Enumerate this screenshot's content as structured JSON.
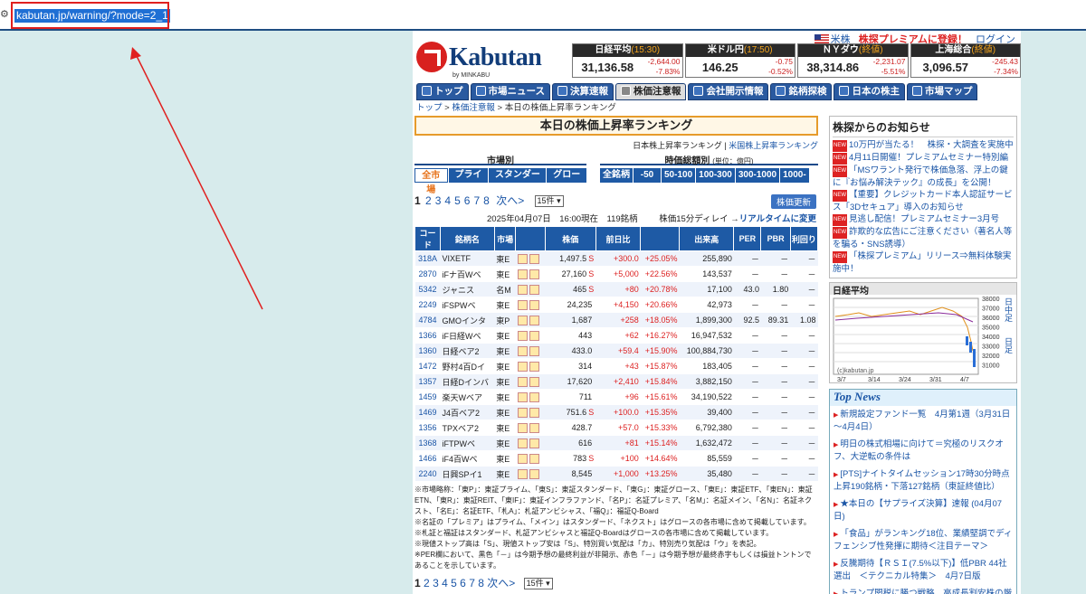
{
  "address": {
    "url": "kabutan.jp/warning/?mode=2_1"
  },
  "header": {
    "logo": "Kabutan",
    "logo_by": "by MINKABU",
    "us_link": "米株",
    "premium_link": "株探プレミアムに登録！",
    "login": "ログイン"
  },
  "tickers": [
    {
      "name": "日経平均",
      "time": "(15:30)",
      "value": "31,136.58",
      "change": "-2,644.00",
      "pct": "-7.83%"
    },
    {
      "name": "米ドル円",
      "time": "(17:50)",
      "value": "146.25",
      "change": "-0.75",
      "pct": "-0.52%"
    },
    {
      "name": "ＮＹダウ",
      "time": "(終値)",
      "value": "38,314.86",
      "change": "-2,231.07",
      "pct": "-5.51%"
    },
    {
      "name": "上海総合",
      "time": "(終値)",
      "value": "3,096.57",
      "change": "-245.43",
      "pct": "-7.34%"
    }
  ],
  "nav": [
    "トップ",
    "市場ニュース",
    "決算速報",
    "株価注意報",
    "会社開示情報",
    "銘柄探検",
    "日本の株主",
    "市場マップ"
  ],
  "breadcrumb": {
    "top": "トップ",
    "section": "株価注意報",
    "current": "本日の株価上昇率ランキング"
  },
  "page_title": "本日の株価上昇率ランキング",
  "sublinks": {
    "jp": "日本株上昇率ランキング",
    "sep": "|",
    "us": "米国株上昇率ランキング"
  },
  "filters": {
    "market_label": "市場別",
    "market": [
      "全市場",
      "プライム",
      "スタンダード",
      "グロース"
    ],
    "cap_label": "時価総額別",
    "cap_unit": "(単位：億円)",
    "cap": [
      "全銘柄",
      "-50",
      "50-100",
      "100-300",
      "300-1000",
      "1000-"
    ]
  },
  "pager": {
    "pages": [
      "1",
      "2",
      "3",
      "4",
      "5",
      "6",
      "7",
      "8"
    ],
    "next": "次へ>",
    "per_page": "15件"
  },
  "update_button": "株価更新",
  "dateline": "2025年04月07日　16:00現在　119銘柄",
  "delay_note": "株価15分ディレイ →",
  "realtime_link": "リアルタイムに変更",
  "table": {
    "headers": [
      "コード",
      "銘柄名",
      "市場",
      "",
      "株価",
      "前日比",
      "",
      "出来高",
      "PER",
      "PBR",
      "利回り"
    ],
    "rows": [
      [
        "318A",
        "VIXETF",
        "東E",
        "1,497.5",
        "S",
        "+300.0",
        "+25.05%",
        "255,890",
        "－",
        "－",
        "－"
      ],
      [
        "2870",
        "iFナ百Wベ",
        "東E",
        "27,160",
        "S",
        "+5,000",
        "+22.56%",
        "143,537",
        "－",
        "－",
        "－"
      ],
      [
        "5342",
        "ジャニス",
        "名M",
        "465",
        "S",
        "+80",
        "+20.78%",
        "17,100",
        "43.0",
        "1.80",
        "－"
      ],
      [
        "2249",
        "iFSPWベ",
        "東E",
        "24,235",
        "",
        "+4,150",
        "+20.66%",
        "42,973",
        "－",
        "－",
        "－"
      ],
      [
        "4784",
        "GMOインタ",
        "東P",
        "1,687",
        "",
        "+258",
        "+18.05%",
        "1,899,300",
        "92.5",
        "89.31",
        "1.08"
      ],
      [
        "1366",
        "iF日経Wベ",
        "東E",
        "443",
        "",
        "+62",
        "+16.27%",
        "16,947,532",
        "－",
        "－",
        "－"
      ],
      [
        "1360",
        "日経ベア2",
        "東E",
        "433.0",
        "",
        "+59.4",
        "+15.90%",
        "100,884,730",
        "－",
        "－",
        "－"
      ],
      [
        "1472",
        "野村4百Dイ",
        "東E",
        "314",
        "",
        "+43",
        "+15.87%",
        "183,405",
        "－",
        "－",
        "－"
      ],
      [
        "1357",
        "日経Dインバ",
        "東E",
        "17,620",
        "",
        "+2,410",
        "+15.84%",
        "3,882,150",
        "－",
        "－",
        "－"
      ],
      [
        "1459",
        "楽天Wベア",
        "東E",
        "711",
        "",
        "+96",
        "+15.61%",
        "34,190,522",
        "－",
        "－",
        "－"
      ],
      [
        "1469",
        "J4百ベア2",
        "東E",
        "751.6",
        "S",
        "+100.0",
        "+15.35%",
        "39,400",
        "－",
        "－",
        "－"
      ],
      [
        "1356",
        "TPXベア2",
        "東E",
        "428.7",
        "",
        "+57.0",
        "+15.33%",
        "6,792,380",
        "－",
        "－",
        "－"
      ],
      [
        "1368",
        "iFTPWベ",
        "東E",
        "616",
        "",
        "+81",
        "+15.14%",
        "1,632,472",
        "－",
        "－",
        "－"
      ],
      [
        "1466",
        "iF4百Wベ",
        "東E",
        "783",
        "S",
        "+100",
        "+14.64%",
        "85,559",
        "－",
        "－",
        "－"
      ],
      [
        "2240",
        "日興SPイ1",
        "東E",
        "8,545",
        "",
        "+1,000",
        "+13.25%",
        "35,480",
        "－",
        "－",
        "－"
      ]
    ]
  },
  "notes": [
    "※市場略称：「東P」：東証プライム、「東S」：東証スタンダード、「東G」：東証グロース、「東E」：東証ETF、「東EN」：東証ETN、「東R」：東証REIT、「東IF」：東証インフラファンド、「名P」：名証プレミア、「名M」：名証メイン、「名N」：名証ネクスト、「名E」：名証ETF、「札A」：札証アンビシャス、「福Q」：福証Q-Board",
    "※名証の「プレミア」はプライム、「メイン」はスタンダード、「ネクスト」はグロースの各市場に含めて掲載しています。",
    "※札証と福証はスタンダード、札証アンビシャスと福証Q-Boardはグロースの各市場に含めて掲載しています。",
    "※現値ストップ高は「S」、現値ストップ安は「S」、特別買い気配は「カ」、特別売り気配は「ウ」を表記。",
    "※PER欄において、黒色「－」は今期予想の最終利益が非開示、赤色「－」は今期予想が最終赤字もしくは損益トントンであることを示しています。"
  ],
  "side": {
    "notice_title": "株探からのお知らせ",
    "notices": [
      "10万円が当たる！　株探・大調査を実施中",
      "4月11日開催！プレミアムセミナー特別編",
      "「MSワラント発行で株価急落、浮上の鍵に『お悩み解決テック』の成長」を公開！",
      "【重要】クレジットカード本人認証サービス「3Dセキュア」導入のお知らせ",
      "見逃し配信！プレミアムセミナー3月号",
      "詐欺的な広告にご注意ください（著名人等を騙る・SNS誘導）",
      "「株探プレミアム」リリース⇒無料体験実施中！"
    ],
    "chart_title": "日経平均",
    "chart_credit": "(c)kabutan.jp",
    "chart_yticks": [
      "38000",
      "37000",
      "36000",
      "35000",
      "34000",
      "33000",
      "32000",
      "31000"
    ],
    "chart_xticks": [
      "3/7",
      "3/14",
      "3/24",
      "3/31",
      "4/7"
    ],
    "chart_tabs": [
      "日中足",
      "日足"
    ],
    "topnews_title": "Top News",
    "topnews": [
      "新規設定ファンド一覧　4月第1週（3月31日～4月4日）",
      "明日の株式相場に向けて＝究極のリスクオフ、大逆転の条件は",
      "[PTS]ナイトタイムセッション17時30分時点 上昇190銘柄・下落127銘柄（東証終値比）",
      "★本日の【サプライズ決算】速報 (04月07日)",
      "「食品」がランキング18位、業績堅調でディフェンシブ性発揮に期待＜注目テーマ＞",
      "反騰期待【ＲＳＩ(7.5%以下)】低PBR 44社選出　＜テクニカル特集＞　4月7日版",
      "トランプ関税に勝つ戦略、高成長割安株の厳選"
    ]
  }
}
